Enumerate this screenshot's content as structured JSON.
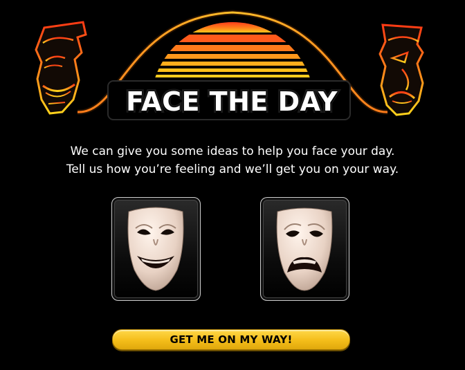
{
  "header": {
    "title": "FACE THE DAY",
    "colors": {
      "sun_top": "#ff4a1c",
      "sun_bottom": "#ffc21a",
      "arc": "#ffb41e"
    }
  },
  "intro": {
    "line1": "We can give you some ideas to help you face your day.",
    "line2": "Tell us how you’re feeling and we’ll get you on your way."
  },
  "moods": [
    {
      "icon": "happy-comedy-mask-icon"
    },
    {
      "icon": "sad-tragedy-mask-icon"
    }
  ],
  "cta": {
    "label": "GET ME ON MY WAY!",
    "color": "#f4bd19"
  },
  "decorations": {
    "left_icon": "tiki-mask-left-icon",
    "right_icon": "tiki-mask-right-icon"
  }
}
